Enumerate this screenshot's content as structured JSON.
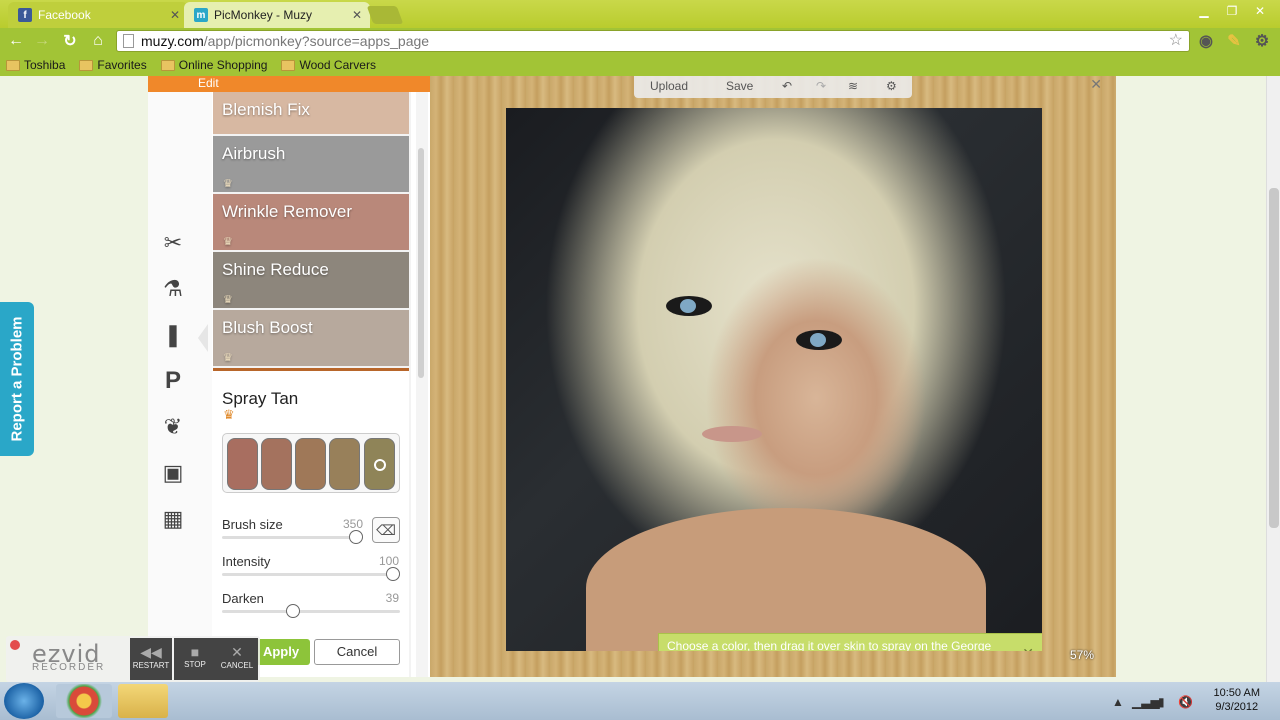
{
  "browser": {
    "tabs": [
      {
        "label": "Facebook",
        "icon": "facebook-icon"
      },
      {
        "label": "PicMonkey - Muzy",
        "icon": "picmonkey-icon"
      }
    ],
    "url_host": "muzy.com",
    "url_path": "/app/picmonkey?source=apps_page",
    "bookmarks": [
      "Toshiba",
      "Favorites",
      "Online Shopping",
      "Wood Carvers"
    ]
  },
  "page": {
    "report_label": "Report a Problem"
  },
  "app": {
    "header_label": "Edit",
    "tools": [
      {
        "label": "Blemish Fix",
        "color": "#d7b8a2"
      },
      {
        "label": "Airbrush",
        "color": "#9a9a9a"
      },
      {
        "label": "Wrinkle Remover",
        "color": "#b9887a"
      },
      {
        "label": "Shine Reduce",
        "color": "#8d867c"
      },
      {
        "label": "Blush Boost",
        "color": "#b7a99d"
      }
    ],
    "toolbar": {
      "upload": "Upload",
      "save": "Save"
    },
    "panel": {
      "title": "Spray Tan",
      "swatches": [
        "#a86e60",
        "#a4725e",
        "#9f7858",
        "#98805a",
        "#8f8458"
      ],
      "brush_label": "Brush size",
      "brush_value": "350",
      "intensity_label": "Intensity",
      "intensity_value": "100",
      "darken_label": "Darken",
      "darken_value": "39",
      "apply_label": "Apply",
      "cancel_label": "Cancel"
    },
    "tooltip": "Choose a color, then drag it over skin to spray on the George Hamilton-ness.",
    "zoom": "57%"
  },
  "recorder": {
    "logo": "ezvid",
    "sub": "RECORDER",
    "restart": "RESTART",
    "stop": "STOP",
    "cancel": "CANCEL"
  },
  "taskbar": {
    "time": "10:50 AM",
    "date": "9/3/2012"
  }
}
